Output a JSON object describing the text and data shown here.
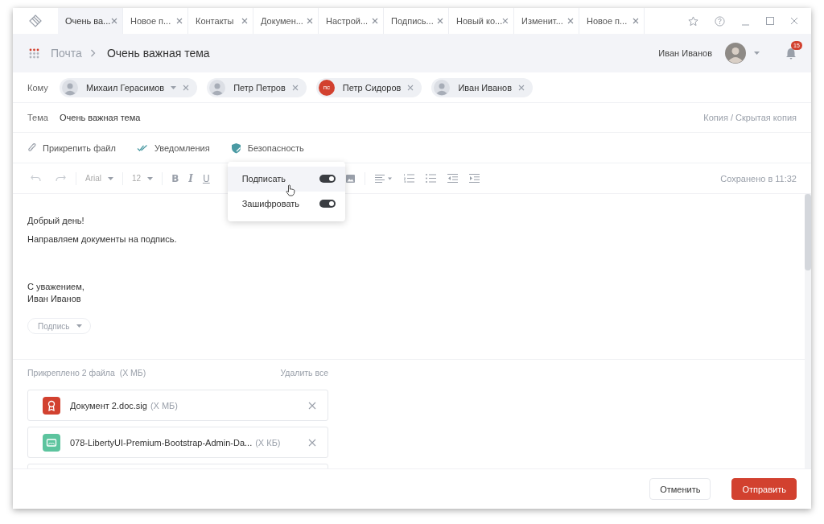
{
  "tabs": [
    {
      "label": "Очень ва...",
      "selected": true
    },
    {
      "label": "Новое п...",
      "selected": false
    },
    {
      "label": "Контакты",
      "selected": false
    },
    {
      "label": "Докумен...",
      "selected": false
    },
    {
      "label": "Настрой...",
      "selected": false
    },
    {
      "label": "Подпись...",
      "selected": false
    },
    {
      "label": "Новый ко...",
      "selected": false
    },
    {
      "label": "Изменит...",
      "selected": false
    },
    {
      "label": "Новое п...",
      "selected": false
    }
  ],
  "header": {
    "breadcrumb": "Почта",
    "title": "Очень важная тема",
    "user": "Иван Иванов",
    "notifications": "15"
  },
  "recipients": {
    "label": "Кому",
    "chips": [
      {
        "name": "Михаил Герасимов",
        "kind": "photo",
        "dropdown": true
      },
      {
        "name": "Петр Петров",
        "kind": "photo",
        "dropdown": false
      },
      {
        "name": "Петр Сидоров",
        "kind": "initials",
        "initials": "пс",
        "color": "#d2412f",
        "dropdown": false
      },
      {
        "name": "Иван Иванов",
        "kind": "photo",
        "dropdown": false
      }
    ]
  },
  "subject": {
    "label": "Тема",
    "value": "Очень важная тема",
    "cc": "Копия / Скрытая копия"
  },
  "actions": [
    {
      "kind": "attach",
      "label": "Прикрепить файл"
    },
    {
      "kind": "notify",
      "label": "Уведомления"
    },
    {
      "kind": "security",
      "label": "Безопасность"
    }
  ],
  "security_menu": [
    {
      "label": "Подписать",
      "on": true,
      "hovered": true
    },
    {
      "label": "Зашифровать",
      "on": true,
      "hovered": false
    }
  ],
  "toolbar": {
    "font": "Arial",
    "size": "12",
    "format": [
      "B",
      "I",
      "U"
    ],
    "saved": "Сохранено в 11:32"
  },
  "body": {
    "paragraphs": [
      "Добрый день!",
      "Направляем документы на подпись."
    ],
    "closing": [
      "С уважением,",
      "Иван Иванов"
    ],
    "signature_select": "Подпись"
  },
  "attachments": {
    "summary": "Прикреплено 2 файла  (Х МБ)",
    "remove_all": "Удалить все",
    "files": [
      {
        "kind": "signature",
        "name": "Документ 2.doc.sig",
        "size": "(Х МБ)"
      },
      {
        "kind": "image",
        "name": "078-LibertyUI-Premium-Bootstrap-Admin-Da...",
        "size": "(Х КБ)"
      }
    ]
  },
  "footer": {
    "cancel": "Отменить",
    "send": "Отправить"
  }
}
